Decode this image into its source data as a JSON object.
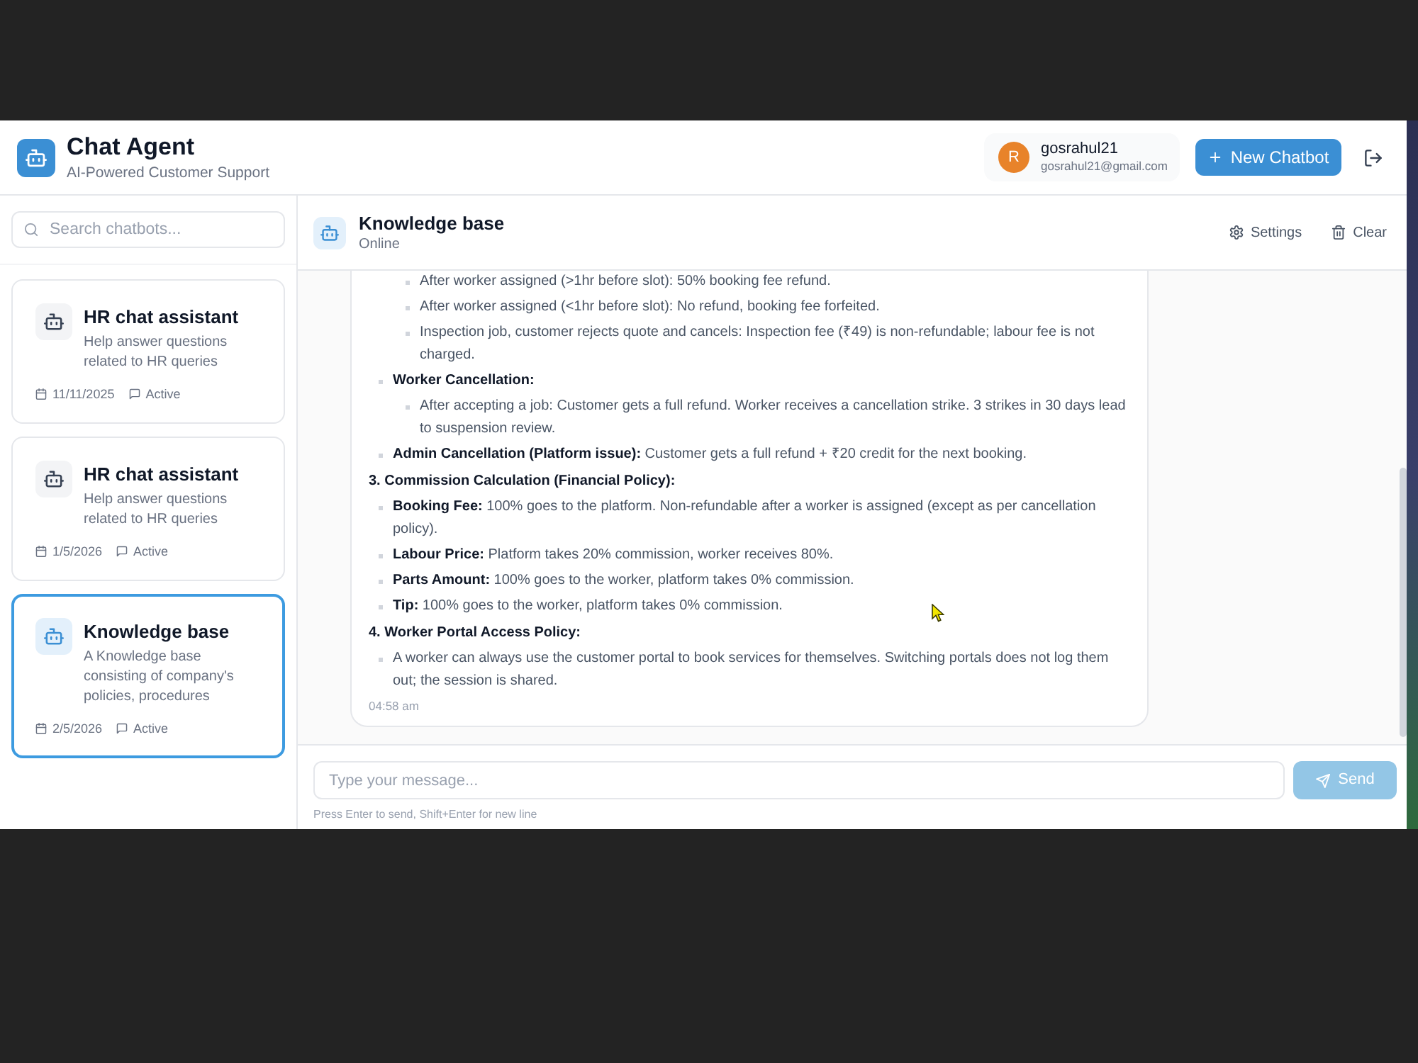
{
  "header": {
    "title": "Chat Agent",
    "subtitle": "AI-Powered Customer Support",
    "user": {
      "initial": "R",
      "name": "gosrahul21",
      "email": "gosrahul21@gmail.com"
    },
    "new_button": {
      "label": "New Chatbot"
    }
  },
  "sidebar": {
    "search": {
      "placeholder": "Search chatbots..."
    },
    "items": [
      {
        "title": "HR chat assistant",
        "description": "Help answer questions related to HR queries",
        "date": "11/11/2025",
        "status": "Active",
        "selected": false
      },
      {
        "title": "HR chat assistant",
        "description": "Help answer questions related to HR queries",
        "date": "1/5/2026",
        "status": "Active",
        "selected": false
      },
      {
        "title": "Knowledge base",
        "description": "A Knowledge base consisting of company's policies, procedures",
        "date": "2/5/2026",
        "status": "Active",
        "selected": true
      }
    ]
  },
  "chat": {
    "title": "Knowledge base",
    "status": "Online",
    "actions": [
      {
        "kind": "settings",
        "label": "Settings"
      },
      {
        "kind": "clear",
        "label": "Clear"
      }
    ],
    "message": {
      "blocks": [
        {
          "kind": "list",
          "items": [
            {
              "kind": "group",
              "children": [
                {
                  "kind": "text",
                  "text": "After worker assigned (>1hr before slot): 50% booking fee refund."
                },
                {
                  "kind": "text",
                  "text": "After worker assigned (<1hr before slot): No refund, booking fee forfeited."
                },
                {
                  "kind": "text",
                  "text": "Inspection job, customer rejects quote and cancels: Inspection fee (₹49) is non-refundable; labour fee is not charged."
                }
              ]
            },
            {
              "kind": "text",
              "text": "**Worker Cancellation:**",
              "children": [
                {
                  "kind": "text",
                  "text": "After accepting a job: Customer gets a full refund. Worker receives a cancellation strike. 3 strikes in 30 days lead to suspension review."
                }
              ]
            },
            {
              "kind": "text",
              "text": "**Admin Cancellation (Platform issue):** Customer gets a full refund + ₹20 credit for the next booking."
            }
          ]
        },
        {
          "kind": "heading",
          "text": "3. Commission Calculation (Financial Policy):"
        },
        {
          "kind": "list",
          "items": [
            {
              "kind": "text",
              "text": "**Booking Fee:** 100% goes to the platform. Non-refundable after a worker is assigned (except as per cancellation policy)."
            },
            {
              "kind": "text",
              "text": "**Labour Price:** Platform takes 20% commission, worker receives 80%."
            },
            {
              "kind": "text",
              "text": "**Parts Amount:** 100% goes to the worker, platform takes 0% commission."
            },
            {
              "kind": "text",
              "text": "**Tip:** 100% goes to the worker, platform takes 0% commission."
            }
          ]
        },
        {
          "kind": "heading",
          "text": "4. Worker Portal Access Policy:"
        },
        {
          "kind": "list",
          "items": [
            {
              "kind": "text",
              "text": "A worker can always use the customer portal to book services for themselves. Switching portals does not log them out; the session is shared."
            }
          ]
        }
      ],
      "time": "04:58 am"
    },
    "input": {
      "placeholder": "Type your message...",
      "hint": "Press Enter to send, Shift+Enter for new line"
    },
    "send_button": {
      "label": "Send",
      "disabled": true
    }
  }
}
